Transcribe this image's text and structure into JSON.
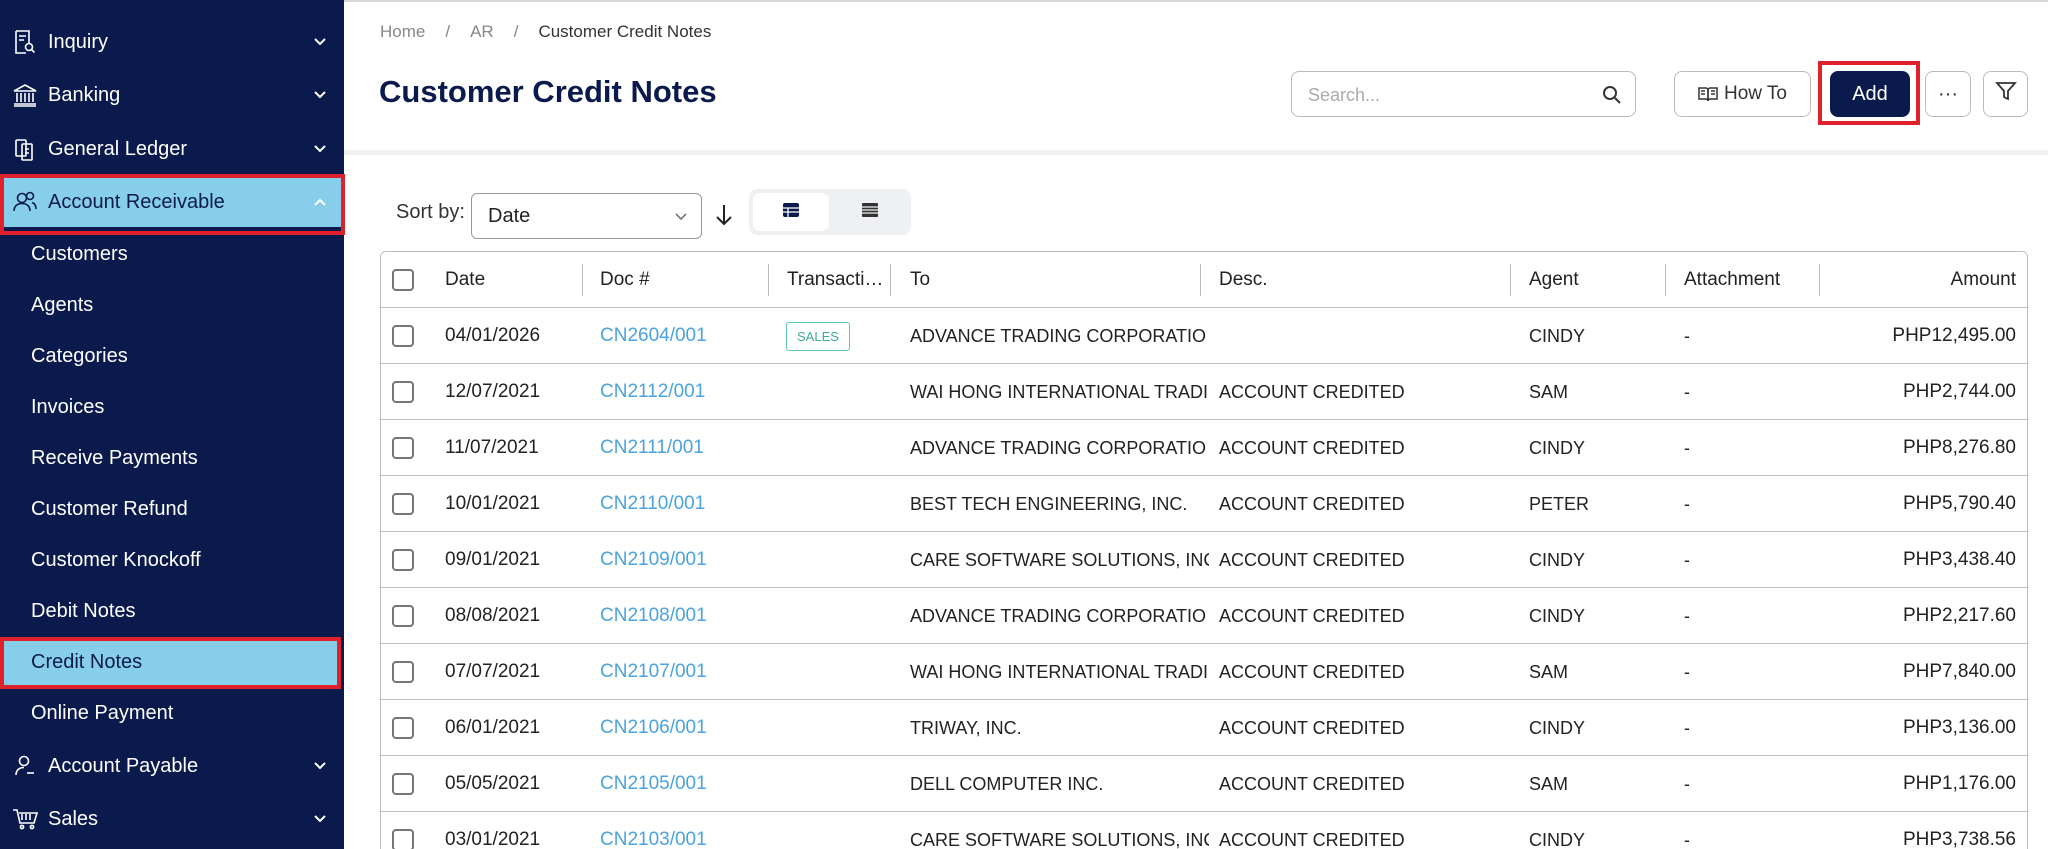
{
  "sidebar": {
    "items": [
      {
        "label": "Inquiry",
        "icon": "inquiry-icon"
      },
      {
        "label": "Banking",
        "icon": "bank-icon"
      },
      {
        "label": "General Ledger",
        "icon": "ledger-icon"
      },
      {
        "label": "Account Receivable",
        "icon": "users-icon",
        "expanded": true
      },
      {
        "label": "Account Payable",
        "icon": "user-icon"
      },
      {
        "label": "Sales",
        "icon": "cart-icon"
      }
    ],
    "sub_items": [
      {
        "label": "Customers"
      },
      {
        "label": "Agents"
      },
      {
        "label": "Categories"
      },
      {
        "label": "Invoices"
      },
      {
        "label": "Receive Payments"
      },
      {
        "label": "Customer Refund"
      },
      {
        "label": "Customer Knockoff"
      },
      {
        "label": "Debit Notes"
      },
      {
        "label": "Credit Notes",
        "active": true
      },
      {
        "label": "Online Payment"
      }
    ]
  },
  "breadcrumb": [
    "Home",
    "AR",
    "Customer Credit Notes"
  ],
  "page_title": "Customer Credit Notes",
  "search": {
    "placeholder": "Search..."
  },
  "toolbar": {
    "howto_label": "How To",
    "add_label": "Add",
    "more_label": "···"
  },
  "sort": {
    "label": "Sort by:",
    "value": "Date"
  },
  "table": {
    "headers": {
      "date": "Date",
      "doc": "Doc #",
      "transaction": "Transacti…",
      "to": "To",
      "desc": "Desc.",
      "agent": "Agent",
      "attachment": "Attachment",
      "amount": "Amount"
    },
    "rows": [
      {
        "date": "04/01/2026",
        "doc": "CN2604/001",
        "transaction": "SALES",
        "to": "ADVANCE TRADING CORPORATIO",
        "desc": "",
        "agent": "CINDY",
        "attachment": "-",
        "amount": "PHP12,495.00"
      },
      {
        "date": "12/07/2021",
        "doc": "CN2112/001",
        "transaction": "",
        "to": "WAI HONG INTERNATIONAL TRADII",
        "desc": "ACCOUNT CREDITED",
        "agent": "SAM",
        "attachment": "-",
        "amount": "PHP2,744.00"
      },
      {
        "date": "11/07/2021",
        "doc": "CN2111/001",
        "transaction": "",
        "to": "ADVANCE TRADING CORPORATIO",
        "desc": "ACCOUNT CREDITED",
        "agent": "CINDY",
        "attachment": "-",
        "amount": "PHP8,276.80"
      },
      {
        "date": "10/01/2021",
        "doc": "CN2110/001",
        "transaction": "",
        "to": "BEST TECH ENGINEERING, INC.",
        "desc": "ACCOUNT CREDITED",
        "agent": "PETER",
        "attachment": "-",
        "amount": "PHP5,790.40"
      },
      {
        "date": "09/01/2021",
        "doc": "CN2109/001",
        "transaction": "",
        "to": "CARE SOFTWARE SOLUTIONS, INC.",
        "desc": "ACCOUNT CREDITED",
        "agent": "CINDY",
        "attachment": "-",
        "amount": "PHP3,438.40"
      },
      {
        "date": "08/08/2021",
        "doc": "CN2108/001",
        "transaction": "",
        "to": "ADVANCE TRADING CORPORATIO",
        "desc": "ACCOUNT CREDITED",
        "agent": "CINDY",
        "attachment": "-",
        "amount": "PHP2,217.60"
      },
      {
        "date": "07/07/2021",
        "doc": "CN2107/001",
        "transaction": "",
        "to": "WAI HONG INTERNATIONAL TRADII",
        "desc": "ACCOUNT CREDITED",
        "agent": "SAM",
        "attachment": "-",
        "amount": "PHP7,840.00"
      },
      {
        "date": "06/01/2021",
        "doc": "CN2106/001",
        "transaction": "",
        "to": "TRIWAY, INC.",
        "desc": "ACCOUNT CREDITED",
        "agent": "CINDY",
        "attachment": "-",
        "amount": "PHP3,136.00"
      },
      {
        "date": "05/05/2021",
        "doc": "CN2105/001",
        "transaction": "",
        "to": "DELL COMPUTER INC.",
        "desc": "ACCOUNT CREDITED",
        "agent": "SAM",
        "attachment": "-",
        "amount": "PHP1,176.00"
      },
      {
        "date": "03/01/2021",
        "doc": "CN2103/001",
        "transaction": "",
        "to": "CARE SOFTWARE SOLUTIONS, INC.",
        "desc": "ACCOUNT CREDITED",
        "agent": "CINDY",
        "attachment": "-",
        "amount": "PHP3,738.56"
      }
    ]
  },
  "colors": {
    "sidebar_bg": "#0b1a4d",
    "active_bg": "#87ceeb",
    "highlight": "#e0202a",
    "link": "#4aa3df",
    "title": "#0b1a4d"
  }
}
